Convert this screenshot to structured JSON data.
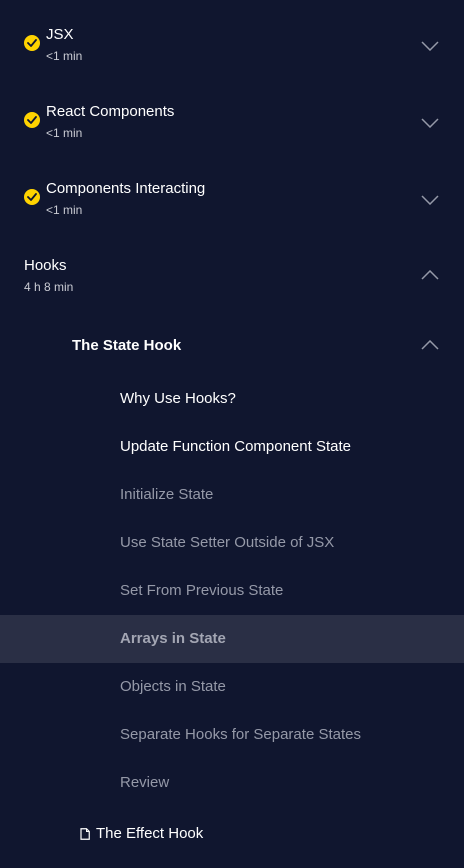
{
  "modules": [
    {
      "title": "JSX",
      "duration": "<1 min",
      "completed": true,
      "expanded": false
    },
    {
      "title": "React Components",
      "duration": "<1 min",
      "completed": true,
      "expanded": false
    },
    {
      "title": "Components Interacting",
      "duration": "<1 min",
      "completed": true,
      "expanded": false
    },
    {
      "title": "Hooks",
      "duration": "4 h 8 min",
      "completed": false,
      "expanded": true
    }
  ],
  "lessons": [
    {
      "title": "The State Hook",
      "expanded": true,
      "items": [
        {
          "label": "Why Use Hooks?",
          "status": "complete"
        },
        {
          "label": "Update Function Component State",
          "status": "complete"
        },
        {
          "label": "Initialize State",
          "status": "pending"
        },
        {
          "label": "Use State Setter Outside of JSX",
          "status": "pending"
        },
        {
          "label": "Set From Previous State",
          "status": "pending"
        },
        {
          "label": "Arrays in State",
          "status": "active"
        },
        {
          "label": "Objects in State",
          "status": "pending"
        },
        {
          "label": "Separate Hooks for Separate States",
          "status": "pending"
        },
        {
          "label": "Review",
          "status": "pending"
        }
      ]
    },
    {
      "title": "The Effect Hook",
      "icon": "document-icon"
    }
  ],
  "colors": {
    "background": "#10162f",
    "check": "#ffd300",
    "active_row": "#2a2f45",
    "muted_text": "#9599a8"
  }
}
